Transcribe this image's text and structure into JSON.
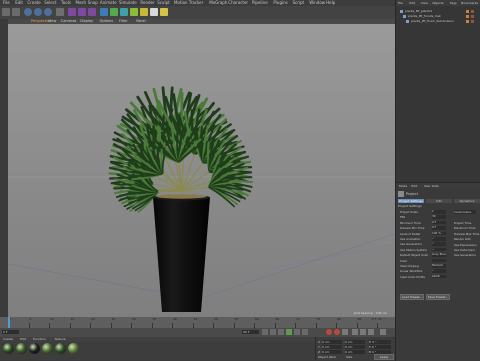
{
  "menubar": {
    "items": [
      "File",
      "Edit",
      "Create",
      "Select",
      "Tools",
      "Mesh",
      "Snap",
      "Animate",
      "Simulate",
      "Render",
      "Sculpt",
      "Motion Tracker",
      "MoGraph",
      "Character",
      "Pipeline",
      "Plugins",
      "Script",
      "Window",
      "Help"
    ]
  },
  "viewport": {
    "menu": [
      "View",
      "Cameras",
      "Display",
      "Options",
      "Filter",
      "Panel"
    ],
    "camera_label": "Perspective",
    "grid_spacing": "Grid Spacing : 100 cm"
  },
  "objects_panel": {
    "menu": [
      "File",
      "Edit",
      "View",
      "Objects",
      "Tags",
      "Bookmarks"
    ],
    "items": [
      "plants_PP_plant01",
      "plants_PP_fronds_mat",
      "plants_PP_Trunk_Subdivision"
    ]
  },
  "attributes_panel": {
    "menu": [
      "Mode",
      "Edit",
      "User Data"
    ],
    "title": "Project",
    "tabs": [
      "Project Settings",
      "Info",
      "Dynamics"
    ],
    "section": "Project Settings",
    "fields": [
      {
        "label": "Project Scale",
        "value": "1"
      },
      {
        "label": "FPS",
        "value": "30"
      },
      {
        "label": "Minimum Time",
        "value": "0 F"
      },
      {
        "label": "Preview Min Time",
        "value": "0 F"
      },
      {
        "label": "Level of Detail",
        "value": "100 %"
      },
      {
        "label": "Use Animation",
        "value": "✓"
      },
      {
        "label": "Use Generators",
        "value": "✓"
      },
      {
        "label": "Use Motion System",
        "value": "✓"
      },
      {
        "label": "Default Object Color",
        "value": "Gray Blue"
      },
      {
        "label": "Color",
        "value": ""
      },
      {
        "label": "View Clipping",
        "value": "Medium"
      },
      {
        "label": "Linear Workflow",
        "value": "✓"
      },
      {
        "label": "Input Color Profile",
        "value": "sRGB"
      }
    ],
    "right_fields": [
      "Project Time",
      "Maximum Time",
      "Preview Max Time",
      "Render LOD",
      "Use Expressions",
      "Use Deformers",
      "Use Generators"
    ],
    "unit": "Centimeters",
    "buttons": [
      "Load Preset...",
      "Save Preset..."
    ]
  },
  "timeline": {
    "ticks": [
      "0",
      "5",
      "10",
      "15",
      "20",
      "25",
      "30",
      "35",
      "40",
      "45",
      "50",
      "55",
      "60",
      "65",
      "70",
      "75",
      "80",
      "85",
      "90"
    ],
    "current_frame": "0 F",
    "end_frame": "90 F",
    "start_label": "0 F",
    "end_label": "90 F"
  },
  "materials": {
    "menu": [
      "Create",
      "Edit",
      "Function",
      "Texture"
    ],
    "count": 6
  },
  "coordinates": {
    "rows": [
      {
        "axis": "X",
        "pos": "0 cm",
        "size": "0 cm",
        "rot": "H 0 °"
      },
      {
        "axis": "Y",
        "pos": "0 cm",
        "size": "0 cm",
        "rot": "P 0 °"
      },
      {
        "axis": "Z",
        "pos": "0 cm",
        "size": "0 cm",
        "rot": "B 0 °"
      }
    ],
    "mode": "Object (Rel)",
    "size_mode": "Size",
    "apply": "Apply"
  },
  "colors": {
    "viewport_bg": "#8c8c8c",
    "pot": "#0b0b0b",
    "leaf_dark": "#1f3d1a",
    "leaf_light": "#4a7a38",
    "accent": "#e08a2c"
  }
}
